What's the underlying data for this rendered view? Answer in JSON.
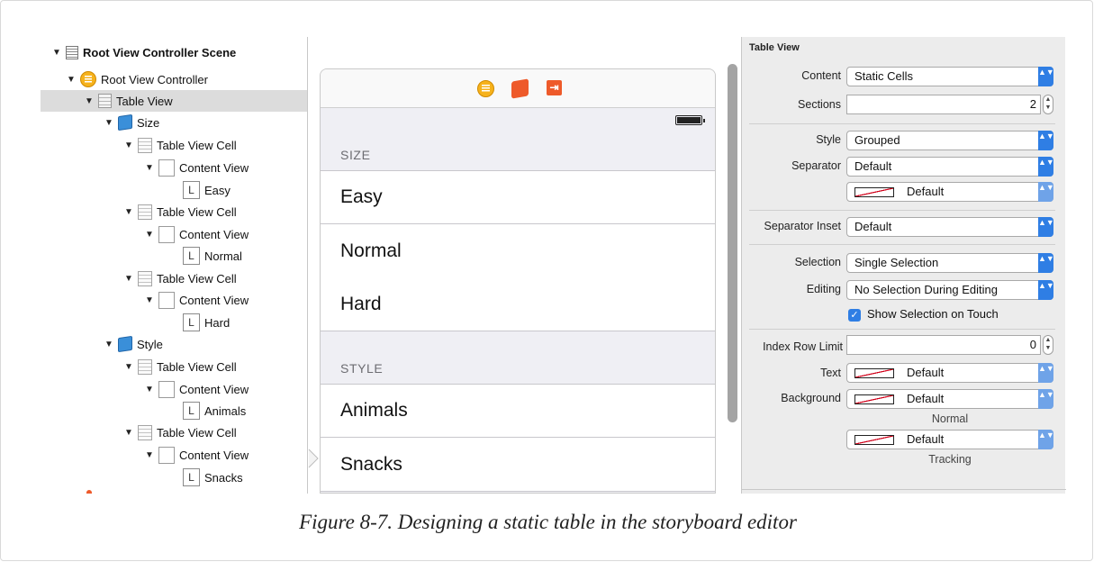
{
  "outline": {
    "items": [
      {
        "label": "Root View Controller Scene",
        "icon": "scene-icon"
      },
      {
        "label": "Root View Controller",
        "icon": "view-controller-icon"
      },
      {
        "label": "Table View",
        "icon": "table-view-icon"
      },
      {
        "label": "Size",
        "icon": "section-cube-icon"
      },
      {
        "label": "Table View Cell",
        "icon": "table-cell-icon"
      },
      {
        "label": "Content View",
        "icon": "view-icon"
      },
      {
        "label": "Easy",
        "icon": "label-icon"
      },
      {
        "label": "Table View Cell",
        "icon": "table-cell-icon"
      },
      {
        "label": "Content View",
        "icon": "view-icon"
      },
      {
        "label": "Normal",
        "icon": "label-icon"
      },
      {
        "label": "Table View Cell",
        "icon": "table-cell-icon"
      },
      {
        "label": "Content View",
        "icon": "view-icon"
      },
      {
        "label": "Hard",
        "icon": "label-icon"
      },
      {
        "label": "Style",
        "icon": "section-cube-icon"
      },
      {
        "label": "Table View Cell",
        "icon": "table-cell-icon"
      },
      {
        "label": "Content View",
        "icon": "view-icon"
      },
      {
        "label": "Animals",
        "icon": "label-icon"
      },
      {
        "label": "Table View Cell",
        "icon": "table-cell-icon"
      },
      {
        "label": "Content View",
        "icon": "view-icon"
      },
      {
        "label": "Snacks",
        "icon": "label-icon"
      }
    ],
    "disclosure": "▼",
    "label_glyph": "L",
    "selected": "Table View"
  },
  "canvas": {
    "dock_exit_glyph": "⇥",
    "sections": [
      {
        "header": "SIZE",
        "cells": [
          "Easy",
          "Normal",
          "Hard"
        ]
      },
      {
        "header": "STYLE",
        "cells": [
          "Animals",
          "Snacks"
        ]
      }
    ]
  },
  "inspector": {
    "title": "Table View",
    "content_label": "Content",
    "content_value": "Static Cells",
    "sections_label": "Sections",
    "sections_value": "2",
    "style_label": "Style",
    "style_value": "Grouped",
    "separator_label": "Separator",
    "separator_value": "Default",
    "separator_color_value": "Default",
    "separator_inset_label": "Separator Inset",
    "separator_inset_value": "Default",
    "selection_label": "Selection",
    "selection_value": "Single Selection",
    "editing_label": "Editing",
    "editing_value": "No Selection During Editing",
    "show_selection_label": "Show Selection on Touch",
    "show_selection_checked": true,
    "index_row_limit_label": "Index Row Limit",
    "index_row_limit_value": "0",
    "text_label": "Text",
    "text_value": "Default",
    "background_label": "Background",
    "background_value": "Default",
    "normal_caption": "Normal",
    "tracking_value": "Default",
    "tracking_caption": "Tracking",
    "popup_arrows": "▲▼",
    "checkmark": "✓"
  },
  "caption": "Figure 8-7. Designing a static table in the storyboard editor",
  "colors": {
    "accent_blue": "#2f7ee4",
    "view_controller_yellow": "#f6b21c",
    "dock_orange": "#ee5a2a",
    "selected_row": "#dcdcdc"
  }
}
